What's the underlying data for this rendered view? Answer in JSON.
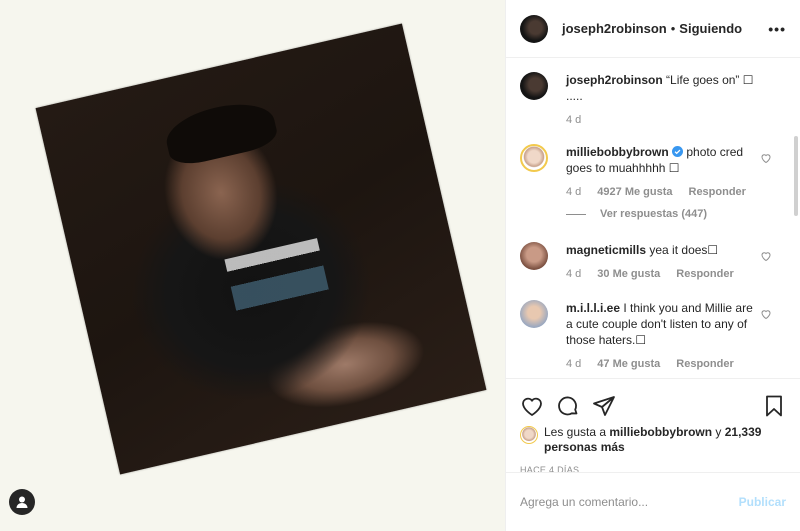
{
  "post": {
    "username": "joseph2robinson",
    "separator": "•",
    "follow_label": "Siguiendo",
    "more_label": "•••"
  },
  "caption": {
    "username": "joseph2robinson",
    "text": "“Life goes on” ☐ .....",
    "time": "4 d"
  },
  "comments": [
    {
      "username": "milliebobbybrown",
      "verified": true,
      "text": "photo cred goes to muahhhhh ☐",
      "time": "4 d",
      "likes": "4927 Me gusta",
      "reply_label": "Responder",
      "view_replies": "Ver respuestas (447)"
    },
    {
      "username": "magneticmills",
      "text": "yea it does☐",
      "time": "4 d",
      "likes": "30 Me gusta",
      "reply_label": "Responder"
    },
    {
      "username": "m.i.l.l.i.ee",
      "text": "I think you and Millie are a cute couple don't listen to any of those haters.☐",
      "time": "4 d",
      "likes": "47 Me gusta",
      "reply_label": "Responder"
    }
  ],
  "likes_summary": {
    "prefix": "Les gusta a ",
    "user": "milliebobbybrown",
    "middle": " y ",
    "count": "21,339 personas más"
  },
  "time_ago": "HACE 4 DÍAS",
  "comment_box": {
    "placeholder": "Agrega un comentario...",
    "post_label": "Publicar"
  },
  "colors": {
    "verified": "#3897f0",
    "publish_disabled": "#b2dffc",
    "muted_text": "#8e8e8e"
  }
}
